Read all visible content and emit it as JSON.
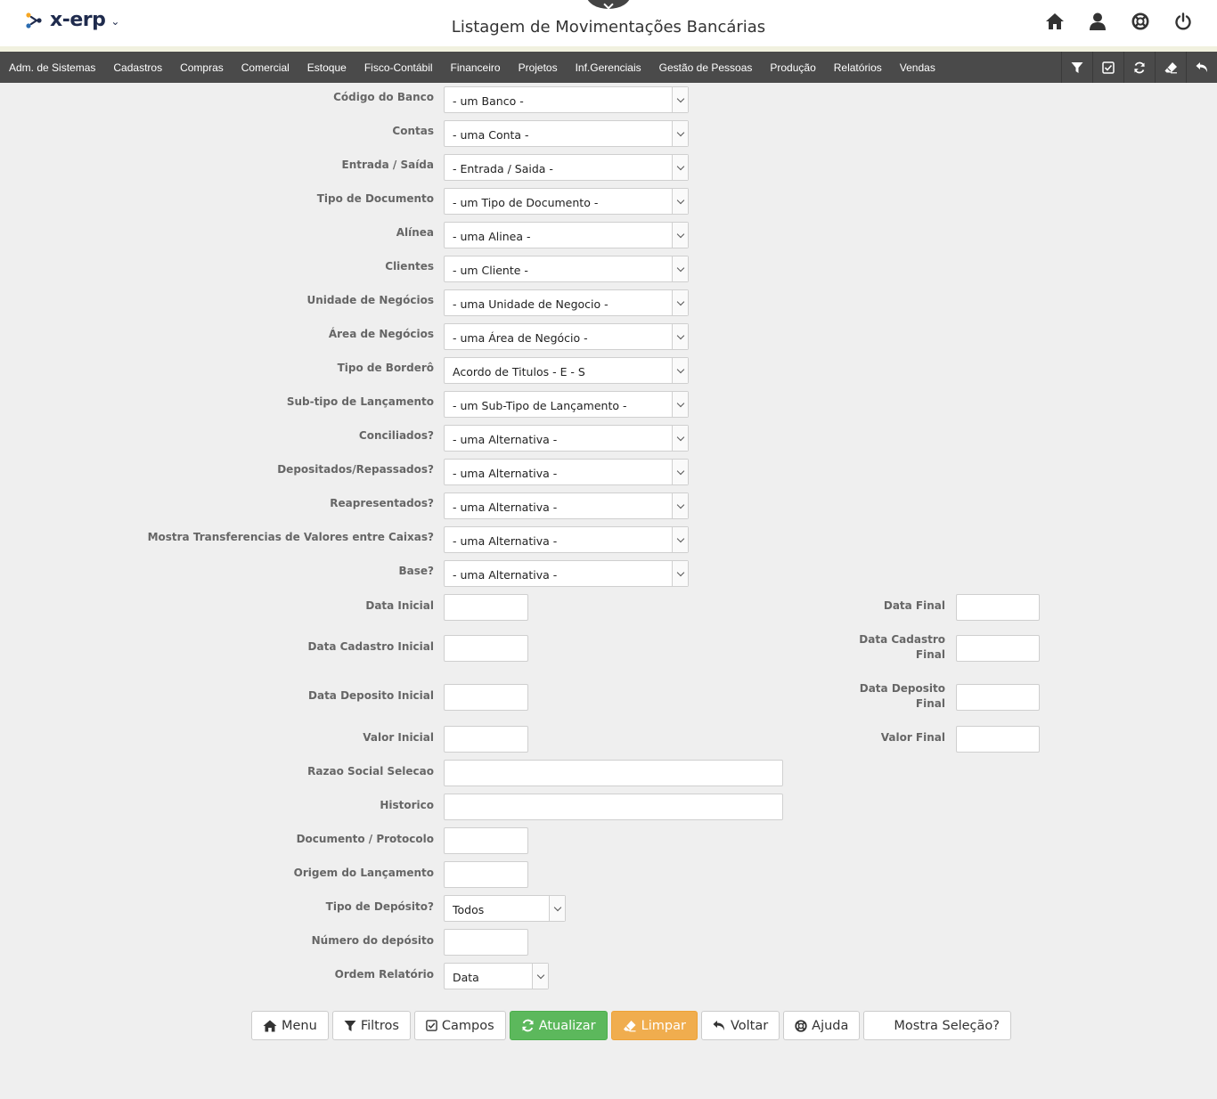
{
  "header": {
    "logo_text": "x-erp",
    "page_title": "Listagem de Movimentações Bancárias"
  },
  "menu": {
    "items": [
      "Adm. de Sistemas",
      "Cadastros",
      "Compras",
      "Comercial",
      "Estoque",
      "Fisco-Contábil",
      "Financeiro",
      "Projetos",
      "Inf.Gerenciais",
      "Gestão de Pessoas",
      "Produção",
      "Relatórios",
      "Vendas"
    ]
  },
  "form": {
    "selects": [
      {
        "label": "Código do Banco",
        "value": "- um Banco -"
      },
      {
        "label": "Contas",
        "value": "- uma Conta -"
      },
      {
        "label": "Entrada / Saída",
        "value": "- Entrada / Saida -"
      },
      {
        "label": "Tipo de Documento",
        "value": "- um Tipo de Documento -"
      },
      {
        "label": "Alínea",
        "value": "- uma Alinea -"
      },
      {
        "label": "Clientes",
        "value": "- um Cliente -"
      },
      {
        "label": "Unidade de Negócios",
        "value": "- uma Unidade de Negocio -"
      },
      {
        "label": "Área de Negócios",
        "value": "- uma Área de Negócio -"
      },
      {
        "label": "Tipo de Borderô",
        "value": "Acordo de Titulos - E - S"
      },
      {
        "label": "Sub-tipo de Lançamento",
        "value": "- um Sub-Tipo de Lançamento -"
      },
      {
        "label": "Conciliados?",
        "value": "- uma Alternativa -"
      },
      {
        "label": "Depositados/Repassados?",
        "value": "- uma Alternativa -"
      },
      {
        "label": "Reapresentados?",
        "value": "- uma Alternativa -"
      },
      {
        "label": "Mostra Transferencias de Valores entre Caixas?",
        "value": "- uma Alternativa -"
      },
      {
        "label": "Base?",
        "value": "- uma Alternativa -"
      }
    ],
    "data_inicial": "Data Inicial",
    "data_final": "Data Final",
    "data_cadastro_inicial": "Data Cadastro Inicial",
    "data_cadastro_final_1": "Data Cadastro",
    "data_cadastro_final_2": "Final",
    "data_deposito_inicial": "Data Deposito Inicial",
    "data_deposito_final_1": "Data Deposito",
    "data_deposito_final_2": "Final",
    "valor_inicial": "Valor Inicial",
    "valor_final": "Valor Final",
    "razao_social": "Razao Social Selecao",
    "historico": "Historico",
    "documento": "Documento / Protocolo",
    "origem": "Origem do Lançamento",
    "tipo_deposito_label": "Tipo de Depósito?",
    "tipo_deposito_value": "Todos",
    "numero_deposito": "Número do depósito",
    "ordem_label": "Ordem Relatório",
    "ordem_value": "Data"
  },
  "buttons": {
    "menu": "Menu",
    "filtros": "Filtros",
    "campos": "Campos",
    "atualizar": "Atualizar",
    "limpar": "Limpar",
    "voltar": "Voltar",
    "ajuda": "Ajuda",
    "mostra_selecao": "Mostra Seleção?"
  },
  "colors": {
    "menubar": "#4a4a4a",
    "atualizar": "#5cb85c",
    "limpar": "#f0ad4e",
    "logo_orange": "#f5a623",
    "logo_blue": "#2b6cb0"
  }
}
